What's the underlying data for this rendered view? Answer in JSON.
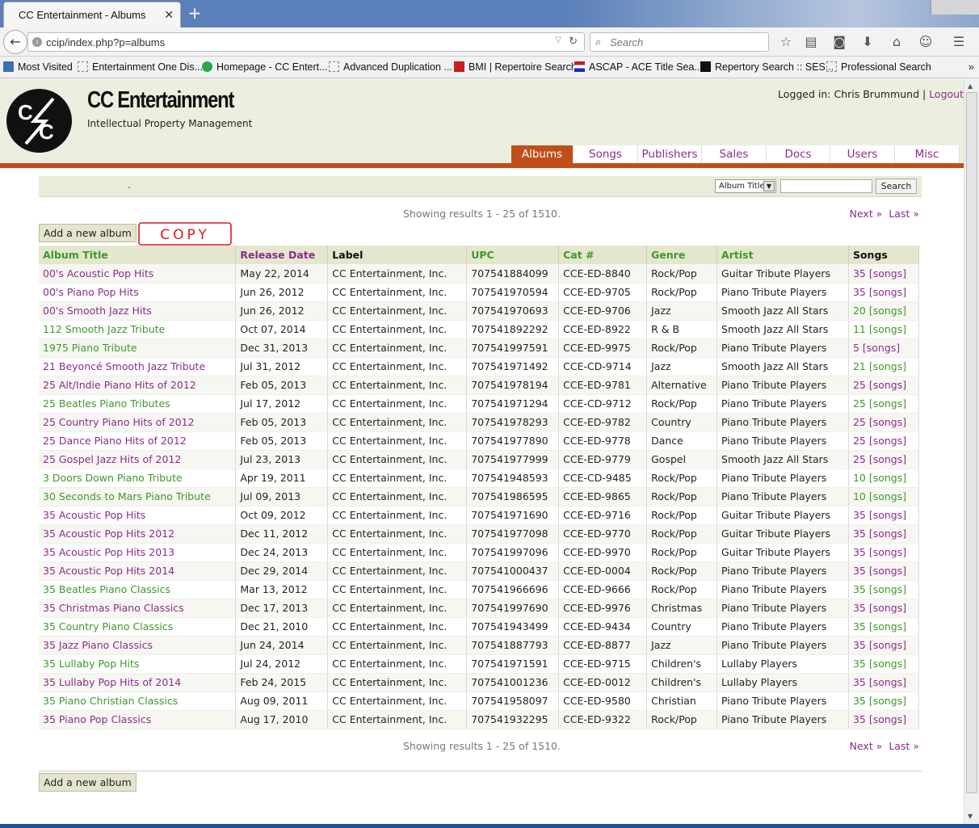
{
  "browser": {
    "tab_title": "CC Entertainment - Albums",
    "url": "ccip/index.php?p=albums",
    "search_placeholder": "Search",
    "bookmarks": [
      {
        "label": "Most Visited",
        "icon": "blue"
      },
      {
        "label": "Entertainment One Dis...",
        "icon": "dash"
      },
      {
        "label": "Homepage - CC Entert...",
        "icon": "green"
      },
      {
        "label": "Advanced Duplication ...",
        "icon": "dash"
      },
      {
        "label": "BMI | Repertoire Search",
        "icon": "red"
      },
      {
        "label": "ASCAP - ACE Title Sea...",
        "icon": "flag"
      },
      {
        "label": "Repertory Search :: SES...",
        "icon": "tri"
      },
      {
        "label": "Professional Search",
        "icon": "dash"
      }
    ]
  },
  "site": {
    "title": "CC Entertainment",
    "subtitle": "Intellectual Property Management",
    "logged_in_prefix": "Logged in: Chris Brummund |",
    "logout": "Logout"
  },
  "nav": [
    "Albums",
    "Songs",
    "Publishers",
    "Sales",
    "Docs",
    "Users",
    "Misc"
  ],
  "filter": {
    "dot": ".",
    "select_value": "Album Title",
    "search_button": "Search"
  },
  "results": {
    "showing": "Showing results 1 - 25 of 1510.",
    "next": "Next »",
    "last": "Last »"
  },
  "add_button": "Add a new album",
  "annotation": "COPY",
  "table": {
    "headers": [
      "Album Title",
      "Release Date",
      "Label",
      "UPC",
      "Cat #",
      "Genre",
      "Artist",
      "Songs"
    ],
    "rows": [
      {
        "title": "00's Acoustic Pop Hits",
        "date": "May 22, 2014",
        "label": "CC Entertainment, Inc.",
        "upc": "707541884099",
        "cat": "CCE-ED-8840",
        "genre": "Rock/Pop",
        "artist": "Guitar Tribute Players",
        "songs": "35 [songs]",
        "green": false
      },
      {
        "title": "00's Piano Pop Hits",
        "date": "Jun 26, 2012",
        "label": "CC Entertainment, Inc.",
        "upc": "707541970594",
        "cat": "CCE-ED-9705",
        "genre": "Rock/Pop",
        "artist": "Piano Tribute Players",
        "songs": "35 [songs]",
        "green": false
      },
      {
        "title": "00's Smooth Jazz Hits",
        "date": "Jun 26, 2012",
        "label": "CC Entertainment, Inc.",
        "upc": "707541970693",
        "cat": "CCE-ED-9706",
        "genre": "Jazz",
        "artist": "Smooth Jazz All Stars",
        "songs": "20 [songs]",
        "green": false,
        "songs_green": true
      },
      {
        "title": "112 Smooth Jazz Tribute",
        "date": "Oct 07, 2014",
        "label": "CC Entertainment, Inc.",
        "upc": "707541892292",
        "cat": "CCE-ED-8922",
        "genre": "R & B",
        "artist": "Smooth Jazz All Stars",
        "songs": "11 [songs]",
        "green": true
      },
      {
        "title": "1975 Piano Tribute",
        "date": "Dec 31, 2013",
        "label": "CC Entertainment, Inc.",
        "upc": "707541997591",
        "cat": "CCE-ED-9975",
        "genre": "Rock/Pop",
        "artist": "Piano Tribute Players",
        "songs": "5 [songs]",
        "green": true,
        "songs_green": false
      },
      {
        "title": "21 Beyoncé Smooth Jazz Tribute",
        "date": "Jul 31, 2012",
        "label": "CC Entertainment, Inc.",
        "upc": "707541971492",
        "cat": "CCE-CD-9714",
        "genre": "Jazz",
        "artist": "Smooth Jazz All Stars",
        "songs": "21 [songs]",
        "green": false,
        "songs_green": true
      },
      {
        "title": "25 Alt/Indie Piano Hits of 2012",
        "date": "Feb 05, 2013",
        "label": "CC Entertainment, Inc.",
        "upc": "707541978194",
        "cat": "CCE-ED-9781",
        "genre": "Alternative",
        "artist": "Piano Tribute Players",
        "songs": "25 [songs]",
        "green": false
      },
      {
        "title": "25 Beatles Piano Tributes",
        "date": "Jul 17, 2012",
        "label": "CC Entertainment, Inc.",
        "upc": "707541971294",
        "cat": "CCE-CD-9712",
        "genre": "Rock/Pop",
        "artist": "Piano Tribute Players",
        "songs": "25 [songs]",
        "green": true
      },
      {
        "title": "25 Country Piano Hits of 2012",
        "date": "Feb 05, 2013",
        "label": "CC Entertainment, Inc.",
        "upc": "707541978293",
        "cat": "CCE-ED-9782",
        "genre": "Country",
        "artist": "Piano Tribute Players",
        "songs": "25 [songs]",
        "green": false
      },
      {
        "title": "25 Dance Piano Hits of 2012",
        "date": "Feb 05, 2013",
        "label": "CC Entertainment, Inc.",
        "upc": "707541977890",
        "cat": "CCE-ED-9778",
        "genre": "Dance",
        "artist": "Piano Tribute Players",
        "songs": "25 [songs]",
        "green": false
      },
      {
        "title": "25 Gospel Jazz Hits of 2012",
        "date": "Jul 23, 2013",
        "label": "CC Entertainment, Inc.",
        "upc": "707541977999",
        "cat": "CCE-ED-9779",
        "genre": "Gospel",
        "artist": "Smooth Jazz All Stars",
        "songs": "25 [songs]",
        "green": false
      },
      {
        "title": "3 Doors Down Piano Tribute",
        "date": "Apr 19, 2011",
        "label": "CC Entertainment, Inc.",
        "upc": "707541948593",
        "cat": "CCE-CD-9485",
        "genre": "Rock/Pop",
        "artist": "Piano Tribute Players",
        "songs": "10 [songs]",
        "green": true
      },
      {
        "title": "30 Seconds to Mars Piano Tribute",
        "date": "Jul 09, 2013",
        "label": "CC Entertainment, Inc.",
        "upc": "707541986595",
        "cat": "CCE-ED-9865",
        "genre": "Rock/Pop",
        "artist": "Piano Tribute Players",
        "songs": "10 [songs]",
        "green": true
      },
      {
        "title": "35 Acoustic Pop Hits",
        "date": "Oct 09, 2012",
        "label": "CC Entertainment, Inc.",
        "upc": "707541971690",
        "cat": "CCE-ED-9716",
        "genre": "Rock/Pop",
        "artist": "Guitar Tribute Players",
        "songs": "35 [songs]",
        "green": false
      },
      {
        "title": "35 Acoustic Pop Hits 2012",
        "date": "Dec 11, 2012",
        "label": "CC Entertainment, Inc.",
        "upc": "707541977098",
        "cat": "CCE-ED-9770",
        "genre": "Rock/Pop",
        "artist": "Guitar Tribute Players",
        "songs": "35 [songs]",
        "green": false
      },
      {
        "title": "35 Acoustic Pop Hits 2013",
        "date": "Dec 24, 2013",
        "label": "CC Entertainment, Inc.",
        "upc": "707541997096",
        "cat": "CCE-ED-9970",
        "genre": "Rock/Pop",
        "artist": "Guitar Tribute Players",
        "songs": "35 [songs]",
        "green": false
      },
      {
        "title": "35 Acoustic Pop Hits 2014",
        "date": "Dec 29, 2014",
        "label": "CC Entertainment, Inc.",
        "upc": "707541000437",
        "cat": "CCE-ED-0004",
        "genre": "Rock/Pop",
        "artist": "Piano Tribute Players",
        "songs": "35 [songs]",
        "green": false
      },
      {
        "title": "35 Beatles Piano Classics",
        "date": "Mar 13, 2012",
        "label": "CC Entertainment, Inc.",
        "upc": "707541966696",
        "cat": "CCE-ED-9666",
        "genre": "Rock/Pop",
        "artist": "Piano Tribute Players",
        "songs": "35 [songs]",
        "green": true
      },
      {
        "title": "35 Christmas Piano Classics",
        "date": "Dec 17, 2013",
        "label": "CC Entertainment, Inc.",
        "upc": "707541997690",
        "cat": "CCE-ED-9976",
        "genre": "Christmas",
        "artist": "Piano Tribute Players",
        "songs": "35 [songs]",
        "green": false
      },
      {
        "title": "35 Country Piano Classics",
        "date": "Dec 21, 2010",
        "label": "CC Entertainment, Inc.",
        "upc": "707541943499",
        "cat": "CCE-ED-9434",
        "genre": "Country",
        "artist": "Piano Tribute Players",
        "songs": "35 [songs]",
        "green": true
      },
      {
        "title": "35 Jazz Piano Classics",
        "date": "Jun 24, 2014",
        "label": "CC Entertainment, Inc.",
        "upc": "707541887793",
        "cat": "CCE-ED-8877",
        "genre": "Jazz",
        "artist": "Piano Tribute Players",
        "songs": "35 [songs]",
        "green": false
      },
      {
        "title": "35 Lullaby Pop Hits",
        "date": "Jul 24, 2012",
        "label": "CC Entertainment, Inc.",
        "upc": "707541971591",
        "cat": "CCE-ED-9715",
        "genre": "Children's",
        "artist": "Lullaby Players",
        "songs": "35 [songs]",
        "green": true
      },
      {
        "title": "35 Lullaby Pop Hits of 2014",
        "date": "Feb 24, 2015",
        "label": "CC Entertainment, Inc.",
        "upc": "707541001236",
        "cat": "CCE-ED-0012",
        "genre": "Children's",
        "artist": "Lullaby Players",
        "songs": "35 [songs]",
        "green": false
      },
      {
        "title": "35 Piano Christian Classics",
        "date": "Aug 09, 2011",
        "label": "CC Entertainment, Inc.",
        "upc": "707541958097",
        "cat": "CCE-ED-9580",
        "genre": "Christian",
        "artist": "Piano Tribute Players",
        "songs": "35 [songs]",
        "green": true
      },
      {
        "title": "35 Piano Pop Classics",
        "date": "Aug 17, 2010",
        "label": "CC Entertainment, Inc.",
        "upc": "707541932295",
        "cat": "CCE-ED-9322",
        "genre": "Rock/Pop",
        "artist": "Piano Tribute Players",
        "songs": "35 [songs]",
        "green": false
      }
    ]
  },
  "colors": {
    "accent": "#c14e1a",
    "link_purple": "#8d2a8d",
    "link_green": "#3b9a2a",
    "header_bg": "#ecefdf"
  }
}
